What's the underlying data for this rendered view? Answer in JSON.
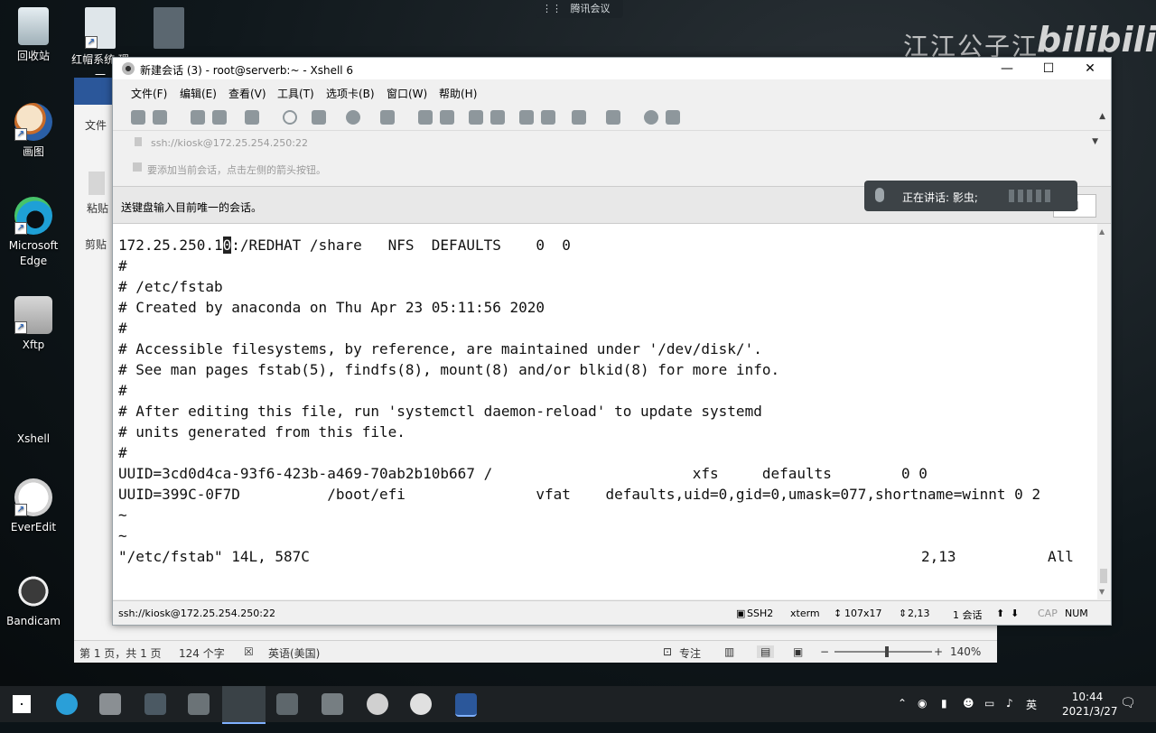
{
  "desktop": {
    "icons": [
      {
        "label": "回收站",
        "icon": "recycle-bin-icon"
      },
      {
        "label": "画图",
        "icon": "paint-icon"
      },
      {
        "label": "Microsoft Edge",
        "icon": "edge-icon"
      },
      {
        "label": "Xftp",
        "icon": "xftp-icon"
      },
      {
        "label": "Xshell",
        "icon": "xshell-icon"
      },
      {
        "label": "EverEdit",
        "icon": "everedit-icon"
      },
      {
        "label": "Bandicam",
        "icon": "bandicam-icon"
      },
      {
        "label": "红帽系统 理一",
        "icon": "document-icon"
      }
    ]
  },
  "meeting": {
    "tab_label": "腾讯会议",
    "speaking_text": "正在讲话: 影虫;"
  },
  "watermark": {
    "text": "江江公子江",
    "logo": "bilibili"
  },
  "word": {
    "ribbon_tab": "文件",
    "paste_label": "粘贴",
    "clipboard_label": "剪贴",
    "status": {
      "page": "第 1 页，共 1 页",
      "words": "124 个字",
      "language": "英语(美国)",
      "focus": "专注",
      "zoom": "140%"
    }
  },
  "xshell": {
    "title": "新建会话 (3) - root@serverb:~ - Xshell 6",
    "menu": [
      "文件(F)",
      "编辑(E)",
      "查看(V)",
      "工具(T)",
      "选项卡(B)",
      "窗口(W)",
      "帮助(H)"
    ],
    "address": "ssh://kiosk@172.25.254.250:22",
    "hint": "要添加当前会话，点击左侧的箭头按钮。",
    "send_bar_text": "送键盘输入目前唯一的会话。",
    "send_button": "N",
    "terminal": {
      "line1_before": "172.25.250.1",
      "line1_cursor": "0",
      "line1_after": ":/REDHAT /share   NFS  DEFAULTS    0  0",
      "lines": [
        "#",
        "# /etc/fstab",
        "# Created by anaconda on Thu Apr 23 05:11:56 2020",
        "#",
        "# Accessible filesystems, by reference, are maintained under '/dev/disk/'.",
        "# See man pages fstab(5), findfs(8), mount(8) and/or blkid(8) for more info.",
        "#",
        "# After editing this file, run 'systemctl daemon-reload' to update systemd",
        "# units generated from this file.",
        "#",
        "UUID=3cd0d4ca-93f6-423b-a469-70ab2b10b667 /                       xfs     defaults        0 0",
        "UUID=399C-0F7D          /boot/efi               vfat    defaults,uid=0,gid=0,umask=077,shortname=winnt 0 2",
        "~",
        "~"
      ],
      "status_left": "\"/etc/fstab\" 14L, 587C",
      "status_pos": "2,13",
      "status_all": "All"
    },
    "statusbar": {
      "address": "ssh://kiosk@172.25.254.250:22",
      "protocol": "SSH2",
      "term": "xterm",
      "size": "107x17",
      "cursor": "2,13",
      "sessions": "1 会话",
      "cap": "CAP",
      "num": "NUM"
    }
  },
  "taskbar": {
    "ime": "英",
    "time": "10:44",
    "date": "2021/3/27"
  }
}
